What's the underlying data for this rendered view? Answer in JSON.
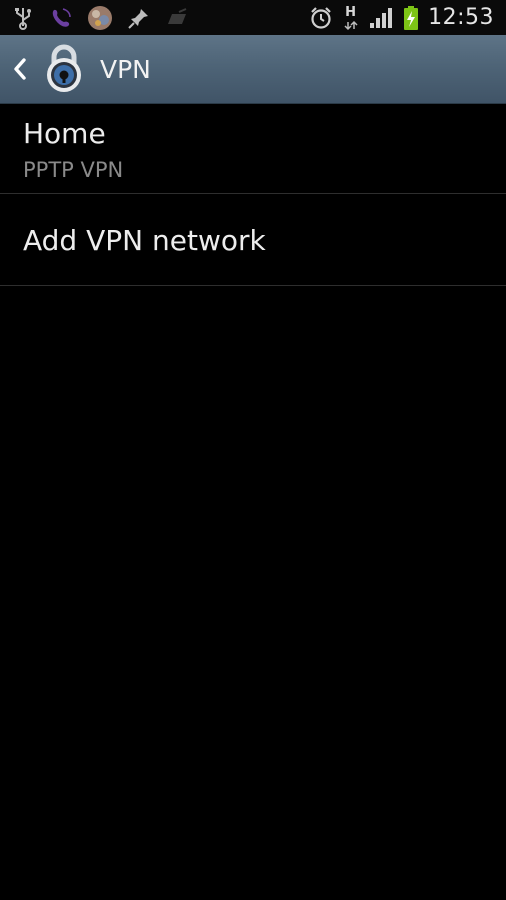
{
  "status_bar": {
    "time": "12:53",
    "network_type": "H",
    "icons": [
      "usb-icon",
      "viber-icon",
      "avatar-icon",
      "pin-icon",
      "sim-card-icon",
      "alarm-icon",
      "network-type-icon",
      "signal-icon",
      "battery-charging-icon"
    ]
  },
  "action_bar": {
    "title": "VPN",
    "icon": "vpn-lock-icon"
  },
  "vpn_list": [
    {
      "name": "Home",
      "type": "PPTP VPN"
    }
  ],
  "add_vpn_label": "Add VPN network",
  "colors": {
    "action_bar": "#4e6477",
    "background": "#000000",
    "primary_text": "#ededed",
    "secondary_text": "#8a8a8a",
    "battery": "#7dc416"
  }
}
